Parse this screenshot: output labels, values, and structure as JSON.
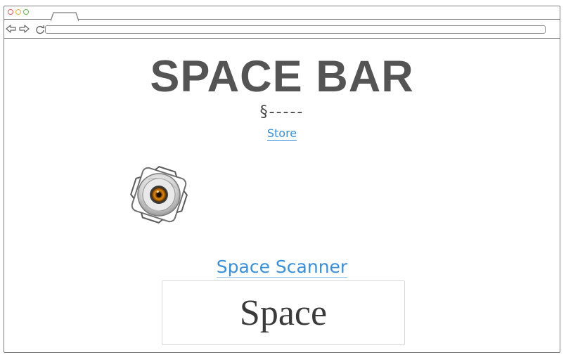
{
  "browser": {
    "tab": {
      "label": ""
    },
    "address_bar": {
      "value": ""
    },
    "icons": {
      "back": "back-arrow-icon",
      "forward": "forward-arrow-icon",
      "reload": "reload-icon"
    }
  },
  "page": {
    "title": "SPACE BAR",
    "balance": "§-----",
    "store_link": "Store",
    "core_image": "portal-core-icon",
    "scanner": {
      "heading": "Space Scanner",
      "value": "Space"
    }
  },
  "colors": {
    "title": "#545454",
    "link": "#3b8fd6",
    "window_border": "#7e7e7e"
  }
}
